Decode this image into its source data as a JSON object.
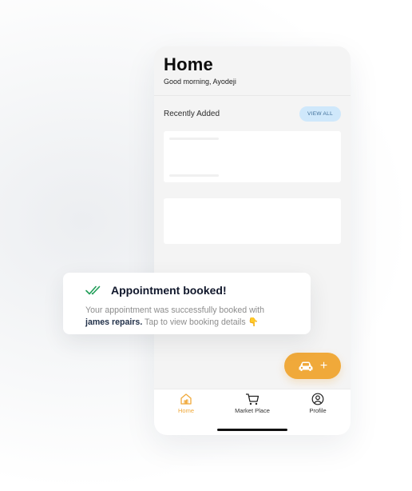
{
  "home": {
    "title": "Home",
    "greeting": "Good morning, Ayodeji"
  },
  "recent": {
    "section_title": "Recently Added",
    "view_all_label": "VIEW ALL"
  },
  "toast": {
    "title": "Appointment booked!",
    "body_prefix": "Your appointment was successfully booked with",
    "body_bold": "james repairs.",
    "body_suffix": " Tap to view booking details 👇",
    "check_icon": "double-check-icon",
    "check_color": "#1f9d57"
  },
  "fab": {
    "icon": "car-icon",
    "plus": "+",
    "color": "#f0a93a"
  },
  "nav": {
    "items": [
      {
        "label": "Home",
        "icon": "home-icon",
        "active": true
      },
      {
        "label": "Market Place",
        "icon": "cart-icon",
        "active": false
      },
      {
        "label": "Profile",
        "icon": "profile-icon",
        "active": false
      }
    ]
  },
  "colors": {
    "accent": "#f0a93a",
    "view_all_bg": "#cfe8fb",
    "view_all_text": "#3d6e98"
  }
}
